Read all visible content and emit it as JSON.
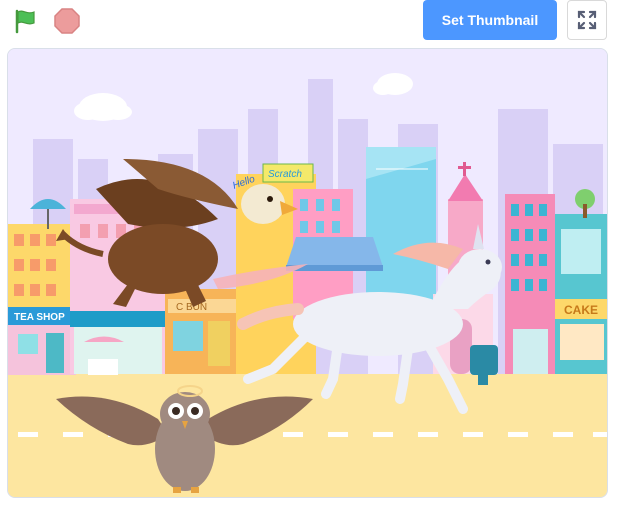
{
  "toolbar": {
    "green_flag_icon": "green-flag-icon",
    "stop_icon": "stop-sign-icon",
    "set_thumbnail_label": "Set Thumbnail",
    "fullscreen_icon": "fullscreen-icon",
    "accent_color": "#4c97ff",
    "flag_color": "#4cbf56",
    "stop_color": "#ec9c9c"
  },
  "stage": {
    "signs": {
      "tea_shop": "TEA SHOP",
      "cake": "CAKE",
      "bun": "C BUN",
      "hello": "Hello",
      "scratch": "Scratch"
    },
    "sprites": [
      "griffin",
      "unicorn",
      "owl"
    ]
  }
}
